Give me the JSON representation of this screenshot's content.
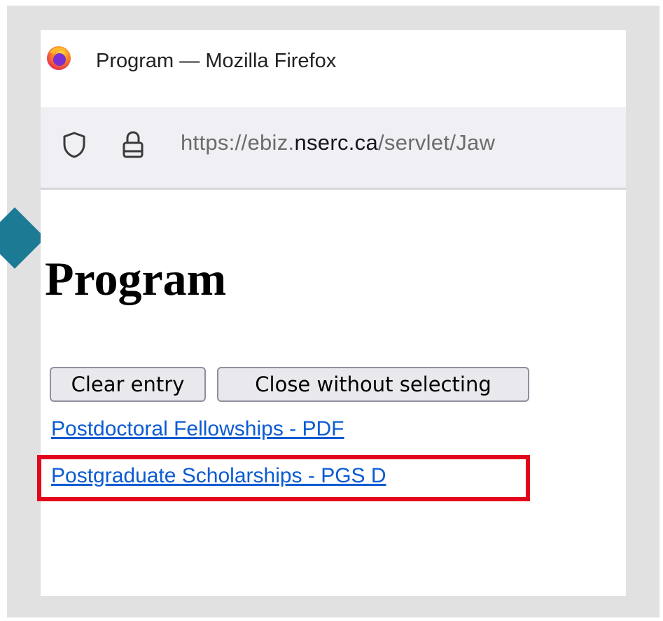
{
  "window": {
    "title": "Program — Mozilla Firefox"
  },
  "urlbar": {
    "url_prefix": "https://ebiz.",
    "url_host": "nserc.ca",
    "url_suffix": "/servlet/Jaw"
  },
  "page": {
    "heading": "Program",
    "buttons": {
      "clear_label": "Clear entry",
      "close_label": "Close without selecting"
    },
    "links": [
      "Postdoctoral Fellowships - PDF",
      "Postgraduate Scholarships - PGS D"
    ]
  },
  "colors": {
    "highlight": "#e3061b",
    "pointer": "#1c7a95",
    "link": "#0b5bd3"
  },
  "icons": {
    "browser": "firefox-logo-icon",
    "tracking": "shield-icon",
    "security": "lock-icon",
    "pointer": "arrow-pointer-icon"
  }
}
